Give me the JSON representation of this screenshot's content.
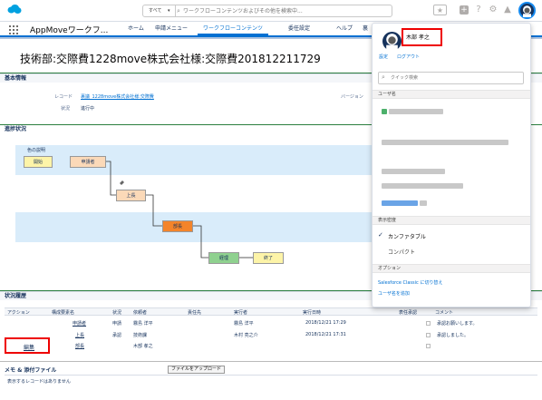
{
  "header": {
    "search_scope": "すべて",
    "search_placeholder": "ワークフローコンテンツおよびその他を検索中..."
  },
  "nav": {
    "app_name": "AppMoveワークフ...",
    "items": [
      "ホーム",
      "申請メニュー",
      "ワークフローコンテンツ",
      "委任設定",
      "ヘルプ",
      "裏"
    ]
  },
  "page": {
    "title": "技術部:交際費1228move株式会社様:交際費201812211729"
  },
  "basic": {
    "heading": "基本情報",
    "record_label": "レコード",
    "record_value": "裏議_1228move株式会社様:交際費",
    "status_label": "状況",
    "status_value": "進行中",
    "version_label": "バージョン"
  },
  "progress": {
    "heading": "進捗状況",
    "legend_title": "色の説明",
    "legend_start": "開始",
    "legend_applicant": "申請者",
    "nodes": {
      "boss": "上長",
      "manager": "部長",
      "accounting": "経理",
      "end": "終了"
    }
  },
  "history": {
    "heading": "状況履歴",
    "columns": [
      "アクション",
      "構成要素名",
      "状況",
      "依頼者",
      "責任先",
      "実行者",
      "実行日時",
      "表任承認",
      "コメント"
    ],
    "rows": [
      {
        "action": "",
        "element": "申請者",
        "status": "申請",
        "requester": "霧島 洋平",
        "assignee": "",
        "executor": "霧島 洋平",
        "datetime": "2018/12/21 17:29",
        "comment": "承認お願いします。"
      },
      {
        "action": "",
        "element": "上長",
        "status": "承認",
        "requester": "技術課",
        "assignee": "",
        "executor": "木村 亮之介",
        "datetime": "2018/12/21 17:31",
        "comment": "承認しました。"
      },
      {
        "action": "編集",
        "element": "部長",
        "status": "",
        "requester": "木部 孝之",
        "assignee": "",
        "executor": "",
        "datetime": "",
        "comment": ""
      }
    ]
  },
  "memo": {
    "heading": "メモ & 添付ファイル",
    "attach_button": "ファイルをアップロード",
    "empty_text": "表示するレコードはありません"
  },
  "user_panel": {
    "user_name": "木部 孝之",
    "settings_link": "設定",
    "logout_link": "ログアウト",
    "quick_search_placeholder": "クイック検索",
    "username_heading": "ユーザ名",
    "density_heading": "表示密度",
    "density_comfortable": "カンファタブル",
    "density_compact": "コンパクト",
    "options_heading": "オプション",
    "switch_classic": "Salesforce Classic に切り替え",
    "add_username": "ユーザ名を追加"
  },
  "colors": {
    "brand": "#0070d2",
    "start": "#fdf4a8",
    "applicant": "#fbd9b8",
    "boss": "#fbd9b8",
    "manager": "#f4842a",
    "accounting": "#8fd18f",
    "end": "#fdf4a8",
    "highlight": "#e00000"
  }
}
